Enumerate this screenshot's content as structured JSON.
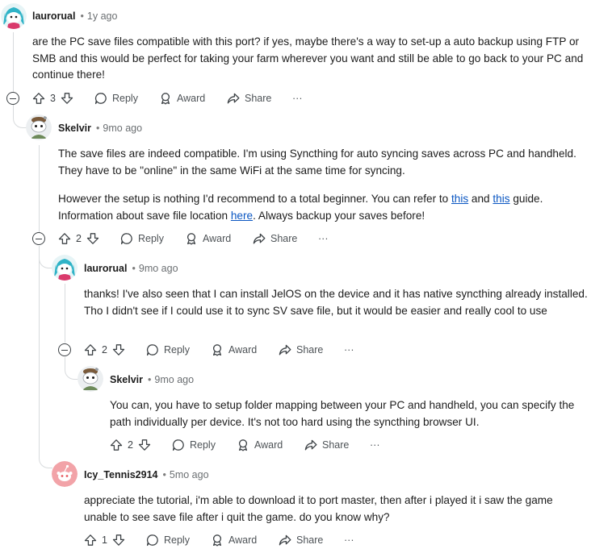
{
  "comments": [
    {
      "author": "laurorual",
      "time": "1y ago",
      "paragraphs": [
        [
          "are the PC save files compatible with this port? if yes, maybe there's a way to set-up a auto backup using FTP or SMB and this would be perfect for taking your farm wherever you want and still be able to go back to your PC and continue there!"
        ]
      ],
      "votes": "3"
    },
    {
      "author": "Skelvir",
      "time": "9mo ago",
      "p1": "The save files are indeed compatible. I'm using Syncthing for auto syncing saves across PC and handheld. They have to be \"online\" in the same WiFi at the same time for syncing.",
      "p2_a": "However the setup is nothing I'd recommend to a total beginner. You can refer to ",
      "link_1": "this",
      "p2_b": " and ",
      "link_2": "this",
      "p2_c": " guide. Information about save file location ",
      "link_3": "here",
      "p2_d": ". Always backup your saves before!",
      "votes": "2"
    },
    {
      "author": "laurorual",
      "time": "9mo ago",
      "text": "thanks! I've also seen that I can install JelOS on the device and it has native syncthing already installed. Tho I didn't see if I could use it to sync SV save file, but it would be easier and really cool to use",
      "votes": "2"
    },
    {
      "author": "Skelvir",
      "time": "9mo ago",
      "text": "You can, you have to setup folder mapping between your PC and handheld, you can specify the path individually per device. It's not too hard using the syncthing browser UI.",
      "votes": "2"
    },
    {
      "author": "Icy_Tennis2914",
      "time": "5mo ago",
      "text": "appreciate the tutorial, i'm able to download it to port master, then after i played it i saw the game unable to see save file after i quit the game. do you know why?",
      "votes": "1"
    }
  ],
  "actions": {
    "reply": "Reply",
    "award": "Award",
    "share": "Share",
    "more": "···"
  },
  "colors": {
    "thread_line": "#d8dbdd",
    "link": "#0a56c2",
    "muted": "#6b6f72",
    "avatar_red": "#f2a3a8"
  }
}
